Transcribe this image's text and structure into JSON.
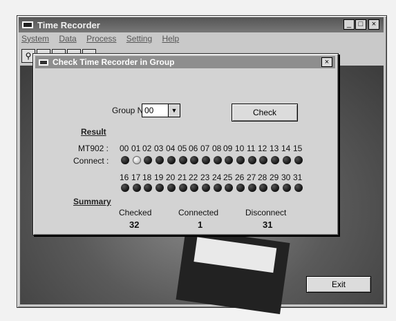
{
  "window": {
    "title": "Time Recorder",
    "min": "_",
    "max": "□",
    "close": "×"
  },
  "menu": [
    "System",
    "Data",
    "Process",
    "Setting",
    "Help"
  ],
  "dialog": {
    "title": "Check Time Recorder in Group",
    "close": "×",
    "group_label": "Group No. :",
    "group_value": "00",
    "check_label": "Check",
    "result_heading": "Result",
    "model_label": "MT902 :",
    "connect_label": "Connect :",
    "row1_ids": [
      "00",
      "01",
      "02",
      "03",
      "04",
      "05",
      "06",
      "07",
      "08",
      "09",
      "10",
      "11",
      "12",
      "13",
      "14",
      "15"
    ],
    "row2_ids": [
      "16",
      "17",
      "18",
      "19",
      "20",
      "21",
      "22",
      "23",
      "24",
      "25",
      "26",
      "27",
      "28",
      "29",
      "30",
      "31"
    ],
    "connected_ids": [
      "01"
    ],
    "summary_heading": "Summary",
    "checked_label": "Checked",
    "checked_value": "32",
    "connected_label": "Connected",
    "connected_value": "1",
    "disconnect_label": "Disconnect",
    "disconnect_value": "31"
  },
  "exit_label": "Exit"
}
